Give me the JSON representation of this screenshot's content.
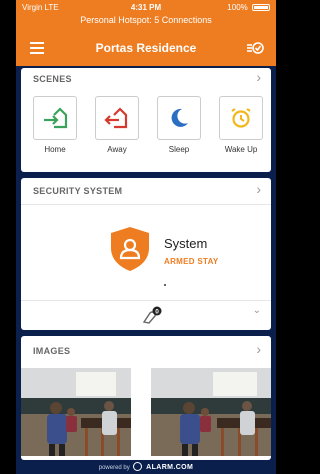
{
  "status_bar": {
    "carrier": "Virgin LTE",
    "time": "4:31 PM",
    "battery": "100%",
    "hotspot": "Personal Hotspot: 5 Connections"
  },
  "app_bar": {
    "title": "Portas Residence",
    "menu_icon": "hamburger-menu-icon",
    "right_icon": "check-list-icon"
  },
  "scenes": {
    "title": "SCENES",
    "items": [
      {
        "label": "Home",
        "icon": "home-arrive-icon",
        "color": "#3aa35b"
      },
      {
        "label": "Away",
        "icon": "home-leave-icon",
        "color": "#d63a2f"
      },
      {
        "label": "Sleep",
        "icon": "moon-icon",
        "color": "#2a6fc2"
      },
      {
        "label": "Wake Up",
        "icon": "alarm-clock-icon",
        "color": "#f2b81b"
      }
    ]
  },
  "security": {
    "title": "SECURITY SYSTEM",
    "system_name": "System",
    "state": "ARMED STAY",
    "indicator_count": "0"
  },
  "images": {
    "title": "IMAGES"
  },
  "footer": {
    "prefix": "powered by",
    "brand": "ALARM.COM"
  },
  "colors": {
    "accent": "#ee7d22",
    "background": "#0b1f4d"
  }
}
